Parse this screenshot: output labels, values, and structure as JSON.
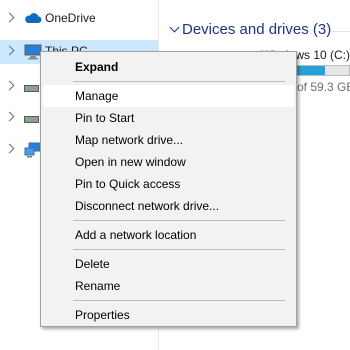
{
  "nav": {
    "items": [
      {
        "label": "OneDrive",
        "icon": "cloud-icon"
      },
      {
        "label": "This PC",
        "icon": "computer-icon"
      },
      {
        "label": "",
        "icon": "drive-icon"
      },
      {
        "label": "",
        "icon": "drive-icon"
      },
      {
        "label": "",
        "icon": "network-icon"
      }
    ]
  },
  "content": {
    "group_header": "Devices and drives (3)",
    "drive_name": "Windows 10 (C:)",
    "drive_free_text": "of 59.3 GB",
    "drive_used_fraction": 0.55
  },
  "context_menu": {
    "items": [
      {
        "label": "Expand",
        "bold": true
      },
      {
        "label": "Manage",
        "hover": true
      },
      {
        "label": "Pin to Start"
      },
      {
        "label": "Map network drive..."
      },
      {
        "label": "Open in new window"
      },
      {
        "label": "Pin to Quick access"
      },
      {
        "label": "Disconnect network drive..."
      },
      {
        "label": "Add a network location"
      },
      {
        "label": "Delete"
      },
      {
        "label": "Rename"
      },
      {
        "label": "Properties"
      }
    ]
  },
  "colors": {
    "selection": "#cce8ff",
    "header_blue": "#1e3287",
    "onedrive_blue": "#0f6cbd",
    "drive_bar_fill": "#26a0da",
    "menu_background": "#f2f2f2"
  }
}
